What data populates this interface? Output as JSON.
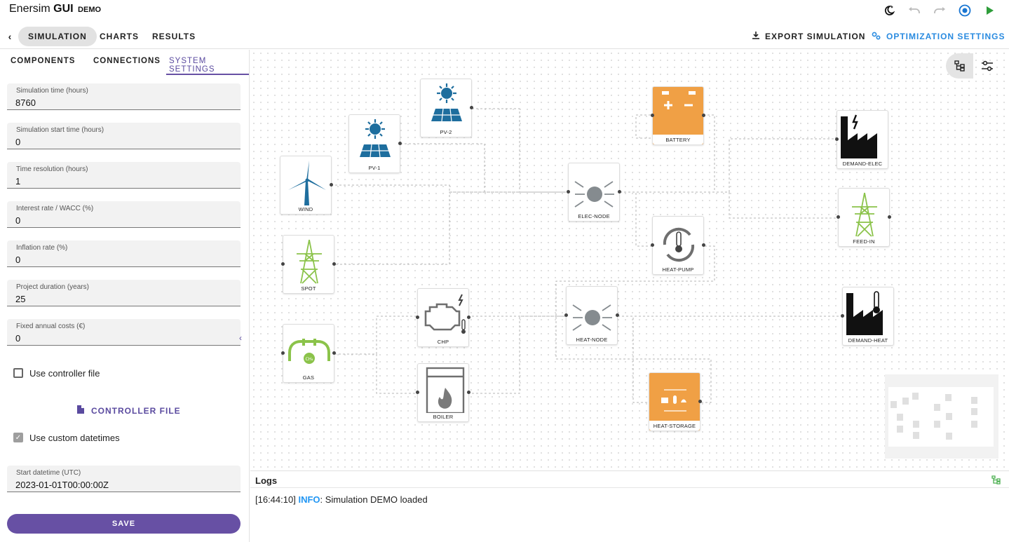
{
  "app": {
    "title_a": "Enersim",
    "title_b": "GUI",
    "title_c": "DEMO"
  },
  "nav": {
    "tabs": [
      {
        "label": "SIMULATION",
        "active": true
      },
      {
        "label": "CHARTS"
      },
      {
        "label": "RESULTS"
      }
    ],
    "export_label": "EXPORT SIMULATION",
    "optimization_label": "OPTIMIZATION SETTINGS"
  },
  "left": {
    "tabs": [
      "COMPONENTS",
      "CONNECTIONS",
      "SYSTEM SETTINGS"
    ],
    "fields": [
      {
        "label": "Simulation time (hours)",
        "value": "8760"
      },
      {
        "label": "Simulation start time (hours)",
        "value": "0"
      },
      {
        "label": "Time resolution (hours)",
        "value": "1"
      },
      {
        "label": "Interest rate / WACC (%)",
        "value": "0"
      },
      {
        "label": "Inflation rate (%)",
        "value": "0"
      },
      {
        "label": "Project duration (years)",
        "value": "25"
      },
      {
        "label": "Fixed annual costs (€)",
        "value": "0"
      }
    ],
    "use_controller_label": "Use controller file",
    "controller_button": "CONTROLLER FILE",
    "use_custom_datetimes_label": "Use custom datetimes",
    "start_datetime": {
      "label": "Start datetime (UTC)",
      "value": "2023-01-01T00:00:00Z"
    },
    "save_label": "SAVE"
  },
  "nodes": {
    "pv2": "PV-2",
    "pv1": "PV-1",
    "wind": "WIND",
    "spot": "SPOT",
    "gas": "GAS",
    "chp": "CHP",
    "boiler": "BOILER",
    "battery": "BATTERY",
    "elec": "ELEC-NODE",
    "heatpump": "HEAT-PUMP",
    "heatnode": "HEAT-NODE",
    "heatstorage": "HEAT-STORAGE",
    "demandelec": "DEMAND-ELEC",
    "feedin": "FEED-IN",
    "demandheat": "DEMAND-HEAT"
  },
  "colors": {
    "accent": "#6750a4",
    "info": "#2196f3",
    "orange": "#f0a045",
    "pv_blue": "#1e6e9e",
    "grid_green": "#8bc34a"
  },
  "logs": {
    "title": "Logs",
    "lines": [
      {
        "time": "[16:44:10]",
        "level": "INFO",
        "message": ": Simulation DEMO loaded"
      }
    ]
  }
}
